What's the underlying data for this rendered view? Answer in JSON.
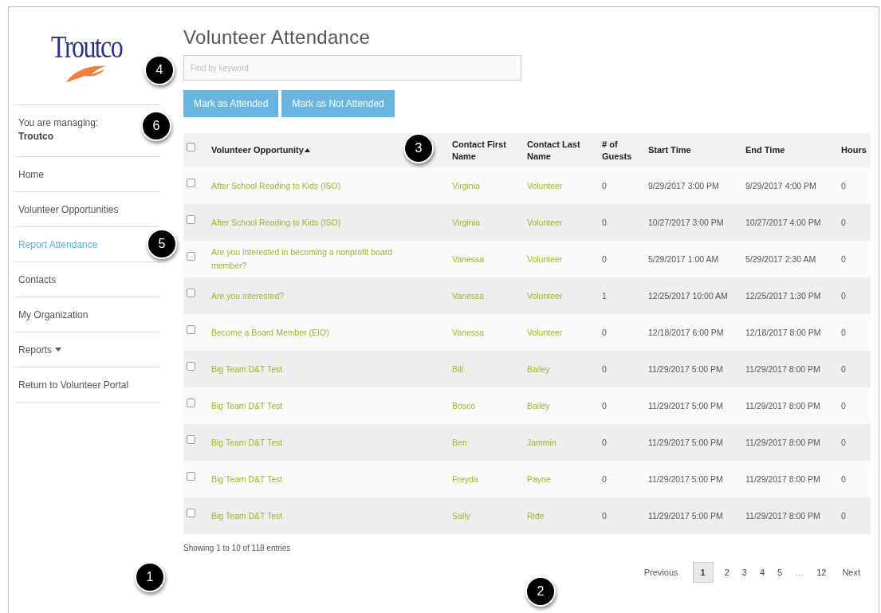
{
  "logo": {
    "text": "Troutco"
  },
  "sidebar": {
    "managing_label": "You are managing:",
    "managing_name": "Troutco",
    "items": [
      {
        "label": "Home",
        "selected": false
      },
      {
        "label": "Volunteer Opportunities",
        "selected": false
      },
      {
        "label": "Report Attendance",
        "selected": true
      },
      {
        "label": "Contacts",
        "selected": false
      },
      {
        "label": "My Organization",
        "selected": false
      },
      {
        "label": "Reports",
        "selected": false,
        "kind": "dropdown"
      },
      {
        "label": "Return to Volunteer Portal",
        "selected": false
      }
    ]
  },
  "page_title": "Volunteer Attendance",
  "search": {
    "placeholder": "Find by keyword"
  },
  "buttons": [
    "Mark as Attended",
    "Mark as Not Attended"
  ],
  "table": {
    "select_all_checked": false,
    "columns": [
      {
        "label": "Volunteer Opportunity",
        "sorted": true
      },
      {
        "label": "Contact First Name",
        "sorted": false
      },
      {
        "label": "Contact Last Name",
        "sorted": false
      },
      {
        "label": "# of Guests",
        "sorted": false
      },
      {
        "label": "Start Time",
        "sorted": false
      },
      {
        "label": "End Time",
        "sorted": false
      },
      {
        "label": "Hours",
        "sorted": false
      }
    ],
    "rows": [
      {
        "checked": false,
        "cells": [
          "After School Reading to Kids (ISO)",
          "Virginia",
          "Volunteer",
          "0",
          "9/29/2017 3:00 PM",
          "9/29/2017 4:00 PM",
          "0"
        ]
      },
      {
        "checked": false,
        "cells": [
          "After School Reading to Kids (ISO)",
          "Virginia",
          "Volunteer",
          "0",
          "10/27/2017 3:00 PM",
          "10/27/2017 4:00 PM",
          "0"
        ]
      },
      {
        "checked": false,
        "cells": [
          "Are you interested in becoming a nonprofit board member?",
          "Vanessa",
          "Volunteer",
          "0",
          "5/29/2017 1:00 AM",
          "5/29/2017 2:30 AM",
          "0"
        ]
      },
      {
        "checked": false,
        "cells": [
          "Are you interested?",
          "Vanessa",
          "Volunteer",
          "1",
          "12/25/2017 10:00 AM",
          "12/25/2017 1:30 PM",
          "0"
        ]
      },
      {
        "checked": false,
        "cells": [
          "Become a Board Member (EIO)",
          "Vanessa",
          "Volunteer",
          "0",
          "12/18/2017 6:00 PM",
          "12/18/2017 8:00 PM",
          "0"
        ]
      },
      {
        "checked": false,
        "cells": [
          "Big Team D&T Test",
          "Bill",
          "Bailey",
          "0",
          "11/29/2017 5:00 PM",
          "11/29/2017 8:00 PM",
          "0"
        ]
      },
      {
        "checked": false,
        "cells": [
          "Big Team D&T Test",
          "Bosco",
          "Bailey",
          "0",
          "11/29/2017 5:00 PM",
          "11/29/2017 8:00 PM",
          "0"
        ]
      },
      {
        "checked": false,
        "cells": [
          "Big Team D&T Test",
          "Ben",
          "Jammin",
          "0",
          "11/29/2017 5:00 PM",
          "11/29/2017 8:00 PM",
          "0"
        ]
      },
      {
        "checked": false,
        "cells": [
          "Big Team D&T Test",
          "Freyda",
          "Payne",
          "0",
          "11/29/2017 5:00 PM",
          "11/29/2017 8:00 PM",
          "0"
        ]
      },
      {
        "checked": false,
        "cells": [
          "Big Team D&T Test",
          "Sally",
          "Ride",
          "0",
          "11/29/2017 5:00 PM",
          "11/29/2017 8:00 PM",
          "0"
        ]
      }
    ]
  },
  "entries_info": "Showing 1 to 10 of 118 entries",
  "pagination": [
    {
      "label": "Previous",
      "kind": "nav",
      "selected": false
    },
    {
      "label": "1",
      "kind": "page",
      "selected": true
    },
    {
      "label": "2",
      "kind": "page",
      "selected": false
    },
    {
      "label": "3",
      "kind": "page",
      "selected": false
    },
    {
      "label": "4",
      "kind": "page",
      "selected": false
    },
    {
      "label": "5",
      "kind": "page",
      "selected": false
    },
    {
      "label": "…",
      "kind": "ellipsis",
      "selected": false
    },
    {
      "label": "12",
      "kind": "page",
      "selected": false
    },
    {
      "label": "Next",
      "kind": "nav",
      "selected": false
    }
  ],
  "callouts": [
    "4",
    "6",
    "3",
    "5",
    "1",
    "2"
  ]
}
